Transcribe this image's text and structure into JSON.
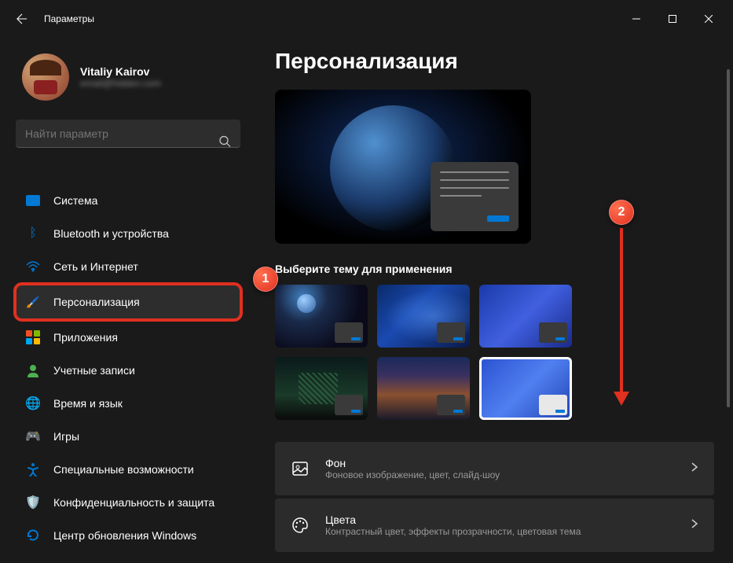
{
  "window": {
    "title": "Параметры"
  },
  "profile": {
    "name": "Vitaliy Kairov",
    "email": "email@hidden.com"
  },
  "search": {
    "placeholder": "Найти параметр"
  },
  "nav": {
    "items": [
      {
        "label": "Система"
      },
      {
        "label": "Bluetooth и устройства"
      },
      {
        "label": "Сеть и Интернет"
      },
      {
        "label": "Персонализация"
      },
      {
        "label": "Приложения"
      },
      {
        "label": "Учетные записи"
      },
      {
        "label": "Время и язык"
      },
      {
        "label": "Игры"
      },
      {
        "label": "Специальные возможности"
      },
      {
        "label": "Конфиденциальность и защита"
      },
      {
        "label": "Центр обновления Windows"
      }
    ]
  },
  "main": {
    "title": "Персонализация",
    "theme_label": "Выберите тему для применения",
    "settings": [
      {
        "title": "Фон",
        "desc": "Фоновое изображение, цвет, слайд-шоу"
      },
      {
        "title": "Цвета",
        "desc": "Контрастный цвет, эффекты прозрачности, цветовая тема"
      }
    ]
  },
  "callouts": {
    "one": "1",
    "two": "2"
  }
}
